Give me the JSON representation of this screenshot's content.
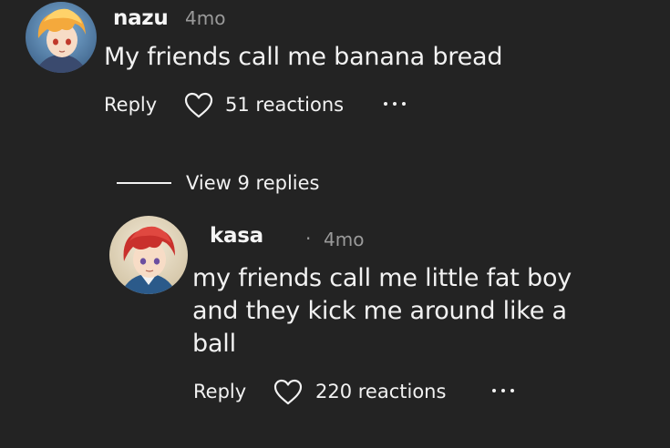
{
  "comments": [
    {
      "username": "nazu",
      "time": "4mo",
      "text": "My friends call me banana bread",
      "reply_label": "Reply",
      "reactions": "51 reactions"
    }
  ],
  "view_replies": "View 9 replies",
  "replies": [
    {
      "username": "kasa",
      "time": "4mo",
      "separator": "·",
      "text_lines": [
        "my friends call me little fat boy",
        "and they kick me around like a",
        "ball"
      ],
      "reply_label": "Reply",
      "reactions": "220 reactions"
    }
  ],
  "icons": {
    "heart": "heart-outline-icon",
    "more": "more-horizontal-icon"
  },
  "colors": {
    "background": "#232323",
    "text": "#f2f2f2",
    "muted": "#9a9a9a"
  }
}
